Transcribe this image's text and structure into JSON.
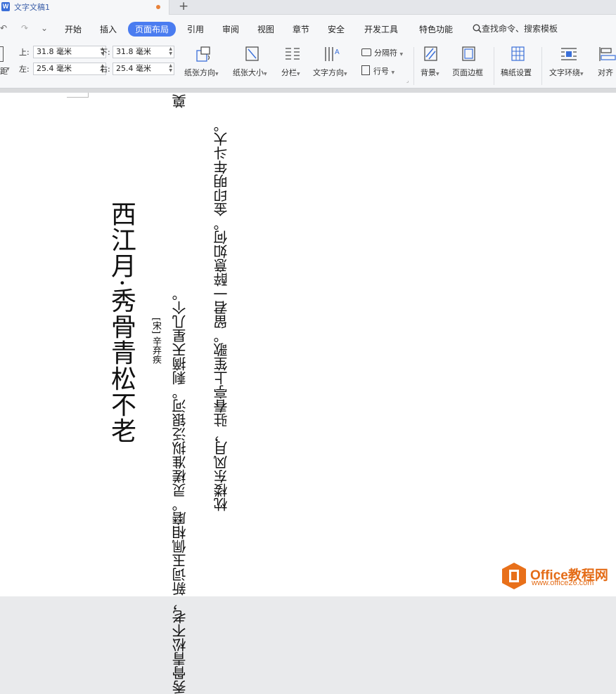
{
  "window": {
    "doc_title": "文字文稿1"
  },
  "menu": {
    "undo": "↶",
    "redo": "↷",
    "more": "⌄",
    "items": [
      "开始",
      "插入",
      "页面布局",
      "引用",
      "审阅",
      "视图",
      "章节",
      "安全",
      "开发工具",
      "特色功能"
    ],
    "search_label": "查找命令、搜索模板"
  },
  "margins": {
    "top_label": "上:",
    "top_value": "31.8 毫米",
    "bottom_label": "下:",
    "bottom_value": "31.8 毫米",
    "left_label": "左:",
    "left_value": "25.4 毫米",
    "right_label": "右:",
    "right_value": "25.4 毫米",
    "cut_label": "距"
  },
  "ribbon": {
    "orientation": "纸张方向",
    "size": "纸张大小",
    "columns": "分栏",
    "text_direction": "文字方向",
    "separator": "分隔符",
    "line_number": "行号",
    "background": "背景",
    "border": "页面边框",
    "manuscript": "稿纸设置",
    "wrap": "文字环绕",
    "align": "对齐"
  },
  "document": {
    "title": "西江月·秀骨青松不老",
    "author": "[宋] 辛弃疾",
    "line1a": "秀骨青松不老，新词玉佩相磨。灵槎准拟泛银河。剩摘天星几个。",
    "line1b": "奠",
    "line2": "枕楼东风月，驻春亭上笙歌。留君一醉意如何。金印明年斗大。"
  },
  "watermark": {
    "brand": "Office教程网",
    "url": "www.office26.com"
  }
}
